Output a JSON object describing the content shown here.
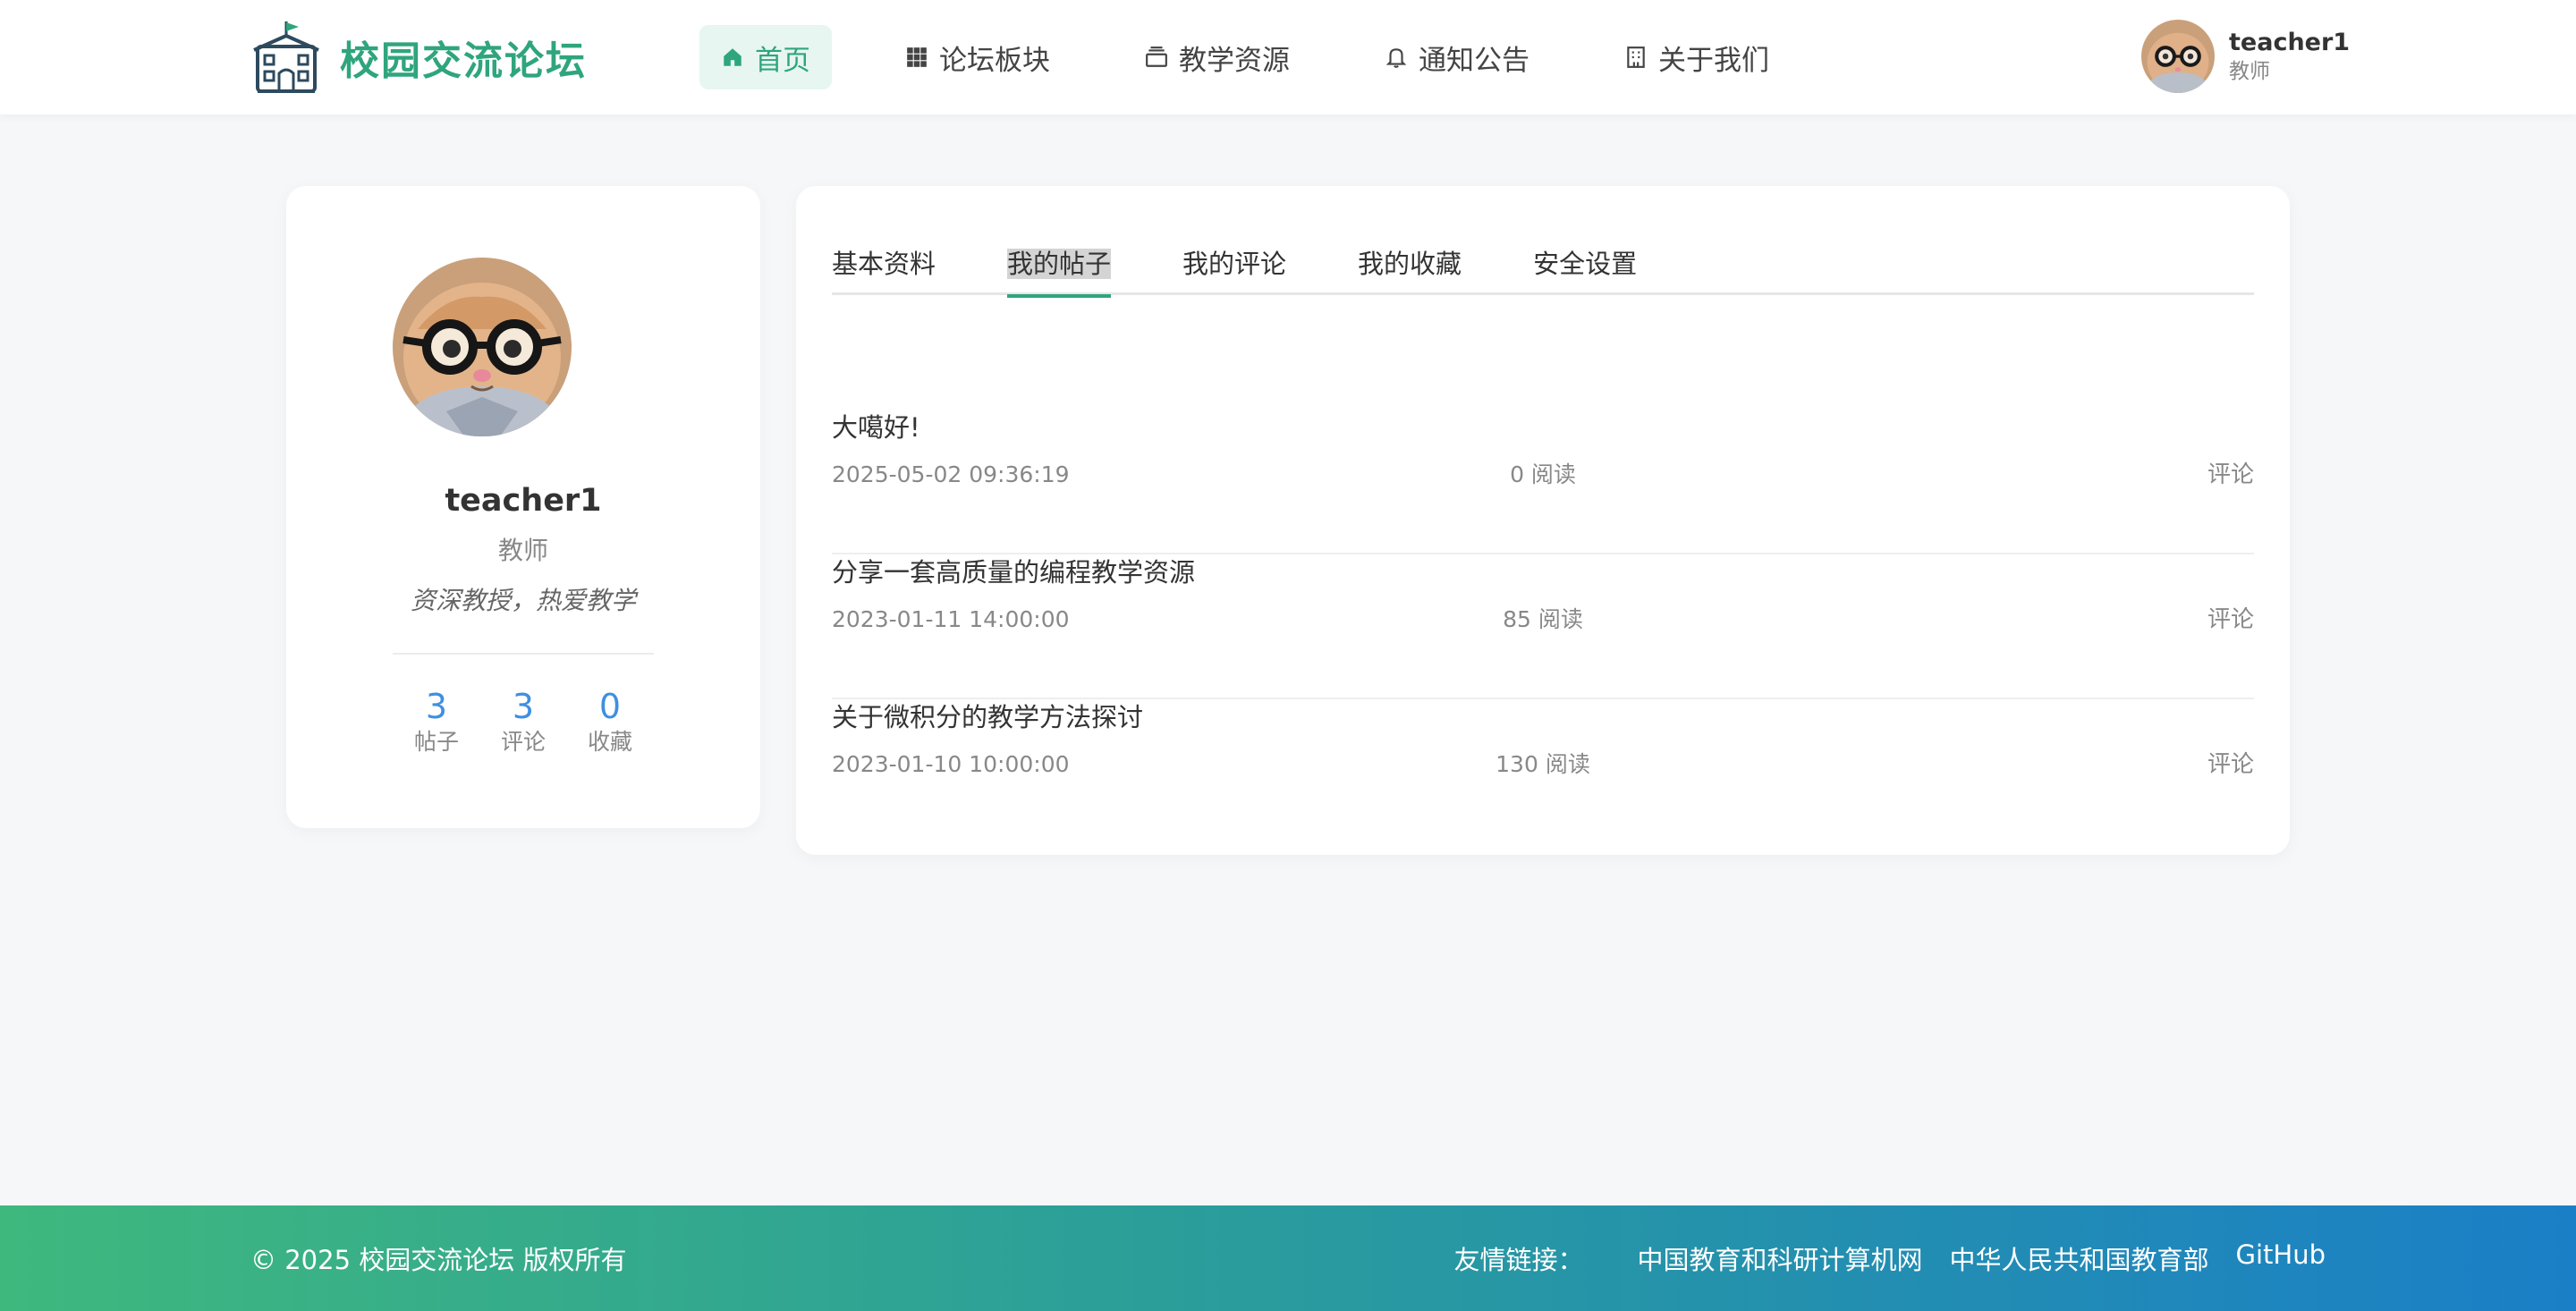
{
  "header": {
    "site_title": "校园交流论坛",
    "nav": [
      {
        "label": "首页",
        "icon": "home-icon",
        "active": true
      },
      {
        "label": "论坛板块",
        "icon": "grid-icon",
        "active": false
      },
      {
        "label": "教学资源",
        "icon": "layers-icon",
        "active": false
      },
      {
        "label": "通知公告",
        "icon": "bell-icon",
        "active": false
      },
      {
        "label": "关于我们",
        "icon": "building-icon",
        "active": false
      }
    ],
    "user": {
      "name": "teacher1",
      "role": "教师"
    }
  },
  "profile": {
    "username": "teacher1",
    "role": "教师",
    "bio": "资深教授，热爱教学",
    "stats": [
      {
        "value": "3",
        "label": "帖子"
      },
      {
        "value": "3",
        "label": "评论"
      },
      {
        "value": "0",
        "label": "收藏"
      }
    ]
  },
  "tabs": [
    {
      "label": "基本资料"
    },
    {
      "label": "我的帖子"
    },
    {
      "label": "我的评论"
    },
    {
      "label": "我的收藏"
    },
    {
      "label": "安全设置"
    }
  ],
  "posts": [
    {
      "title": "大噶好!",
      "date": "2025-05-02 09:36:19",
      "views": "0 阅读",
      "action": "评论"
    },
    {
      "title": "分享一套高质量的编程教学资源",
      "date": "2023-01-11 14:00:00",
      "views": "85 阅读",
      "action": "评论"
    },
    {
      "title": "关于微积分的教学方法探讨",
      "date": "2023-01-10 10:00:00",
      "views": "130 阅读",
      "action": "评论"
    }
  ],
  "footer": {
    "copyright": "© 2025 校园交流论坛 版权所有",
    "links_label": "友情链接：",
    "links": [
      "中国教育和科研计算机网",
      "中华人民共和国教育部",
      "GitHub"
    ]
  },
  "colors": {
    "accent": "#2fa57d",
    "stat_blue": "#3f8fe0",
    "footer_start": "#3fb87e",
    "footer_end": "#1b7fc7"
  }
}
